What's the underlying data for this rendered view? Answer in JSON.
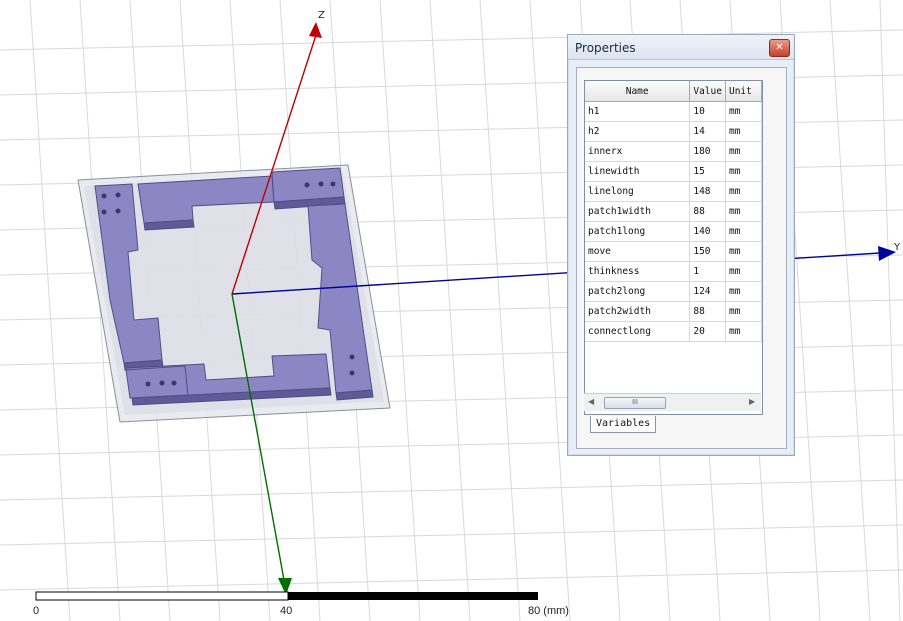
{
  "viewport": {
    "axes": {
      "z_label": "Z",
      "y_label": "Y"
    },
    "scale_bar": {
      "labels": [
        "0",
        "40",
        "80 (mm)"
      ]
    }
  },
  "properties": {
    "title": "Properties",
    "close_glyph": "✕",
    "columns": [
      "Name",
      "Value",
      "Unit"
    ],
    "rows": [
      {
        "name": "h1",
        "value": "10",
        "unit": "mm"
      },
      {
        "name": "h2",
        "value": "14",
        "unit": "mm"
      },
      {
        "name": "innerx",
        "value": "180",
        "unit": "mm"
      },
      {
        "name": "linewidth",
        "value": "15",
        "unit": "mm"
      },
      {
        "name": "linelong",
        "value": "148",
        "unit": "mm"
      },
      {
        "name": "patch1width",
        "value": "88",
        "unit": "mm"
      },
      {
        "name": "patch1long",
        "value": "140",
        "unit": "mm"
      },
      {
        "name": "move",
        "value": "150",
        "unit": "mm"
      },
      {
        "name": "thinkness",
        "value": "1",
        "unit": "mm"
      },
      {
        "name": "patch2long",
        "value": "124",
        "unit": "mm"
      },
      {
        "name": "patch2width",
        "value": "88",
        "unit": "mm"
      },
      {
        "name": "connectlong",
        "value": "20",
        "unit": "mm"
      }
    ],
    "scroll_thumb_glyph": "III",
    "tab_label": "Variables"
  },
  "colors": {
    "z_axis": "#c00000",
    "y_axis": "#0000a0",
    "x_axis": "#007000",
    "model": "#8c87c4",
    "grid": "#d6d6d6"
  }
}
